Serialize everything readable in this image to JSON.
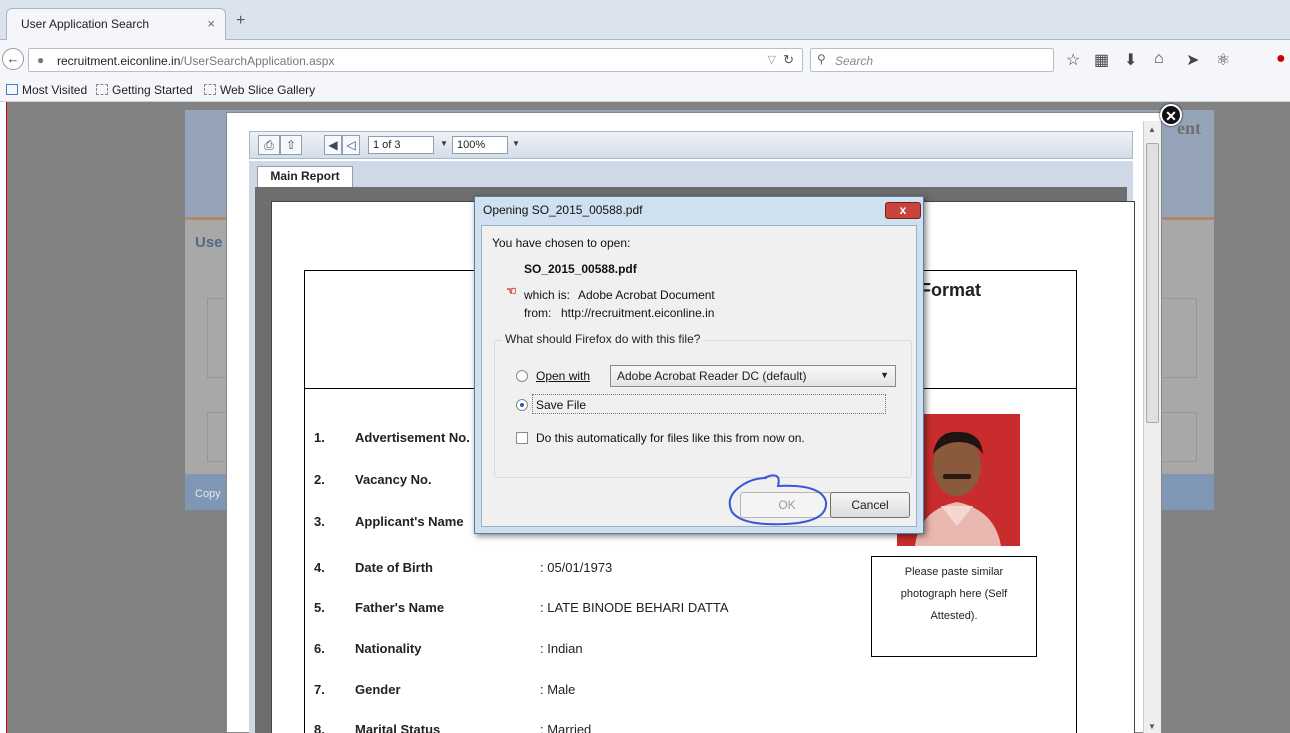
{
  "browser": {
    "tab_title": "User Application Search",
    "tab_close": "×",
    "new_tab": "+",
    "url_host": "recruitment.eiconline.in",
    "url_path": "/UserSearchApplication.aspx",
    "search_placeholder": "Search",
    "bookmarks": [
      "Most Visited",
      "Getting Started",
      "Web Slice Gallery"
    ]
  },
  "background_page": {
    "heading": "Use",
    "header_text": "ent",
    "footer_text": "Copy"
  },
  "report_viewer": {
    "page_indicator": "1 of 3",
    "zoom": "100%",
    "tab_label": "Main Report",
    "form_title": "Format",
    "rows": [
      {
        "num": "1.",
        "label": "Advertisement No.",
        "value": ""
      },
      {
        "num": "2.",
        "label": "Vacancy No.",
        "value": ""
      },
      {
        "num": "3.",
        "label": "Applicant's Name",
        "value": ""
      },
      {
        "num": "4.",
        "label": "Date of Birth",
        "value": ":  05/01/1973"
      },
      {
        "num": "5.",
        "label": "Father's Name",
        "value": ":  LATE BINODE BEHARI DATTA"
      },
      {
        "num": "6.",
        "label": "Nationality",
        "value": ":  Indian"
      },
      {
        "num": "7.",
        "label": "Gender",
        "value": ":  Male"
      },
      {
        "num": "8.",
        "label": "Marital Status",
        "value": ":  Married"
      }
    ],
    "paste_box": [
      "Please paste  similar",
      "photograph here (Self",
      "Attested)."
    ]
  },
  "dialog": {
    "title": "Opening SO_2015_00588.pdf",
    "close": "x",
    "chosen_text": "You have chosen to open:",
    "filename": "SO_2015_00588.pdf",
    "which_is_label": "which is:",
    "which_is_value": "Adobe Acrobat Document",
    "from_label": "from:",
    "from_value": "http://recruitment.eiconline.in",
    "question": "What should Firefox do with this file?",
    "open_with_label": "Open with",
    "open_with_app": "Adobe Acrobat Reader DC  (default)",
    "save_file_label": "Save File",
    "auto_label": "Do this automatically for files like this from now on.",
    "ok_label": "OK",
    "cancel_label": "Cancel",
    "selected_option": "Save File"
  },
  "colors": {
    "dialog_frame": "#cfe0f1",
    "close_red": "#c7433b",
    "annotation_ink": "#3a55d6",
    "photo_bg": "#c92c2c"
  }
}
